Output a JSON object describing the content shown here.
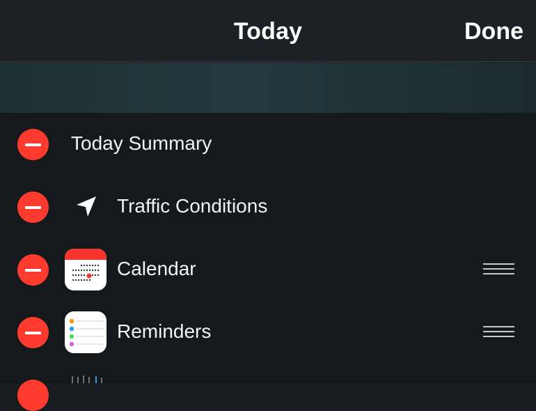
{
  "header": {
    "title": "Today",
    "done_label": "Done"
  },
  "widgets": [
    {
      "label": "Today Summary",
      "icon": null,
      "reorderable": false
    },
    {
      "label": "Traffic Conditions",
      "icon": "location-arrow-icon",
      "reorderable": false
    },
    {
      "label": "Calendar",
      "icon": "calendar-icon",
      "reorderable": true
    },
    {
      "label": "Reminders",
      "icon": "reminders-icon",
      "reorderable": true
    }
  ],
  "colors": {
    "delete_red": "#ff3b30",
    "background": "#181c20",
    "text": "#ffffff"
  }
}
